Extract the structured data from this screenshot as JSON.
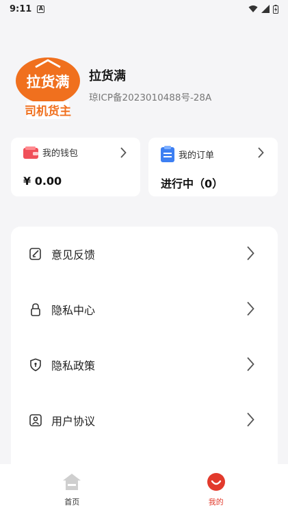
{
  "status_bar": {
    "time": "9:11",
    "notif_letter": "A"
  },
  "profile": {
    "logo_text_top": "拉货满",
    "logo_text_bottom": "司机货主",
    "app_name": "拉货满",
    "icp": "琼ICP备2023010488号-28A"
  },
  "wallet": {
    "label": "我的钱包",
    "value": "¥ 0.00"
  },
  "orders": {
    "label": "我的订单",
    "value": "进行中（0）"
  },
  "menu": {
    "items": [
      {
        "label": "意见反馈",
        "icon": "feedback-icon"
      },
      {
        "label": "隐私中心",
        "icon": "lock-icon"
      },
      {
        "label": "隐私政策",
        "icon": "shield-icon"
      },
      {
        "label": "用户协议",
        "icon": "user-agreement-icon"
      }
    ]
  },
  "tabs": [
    {
      "label": "首页",
      "icon": "home-icon"
    },
    {
      "label": "我的",
      "icon": "mine-icon"
    }
  ],
  "colors": {
    "accent": "#e23a2c",
    "logo_orange": "#f0701e"
  }
}
